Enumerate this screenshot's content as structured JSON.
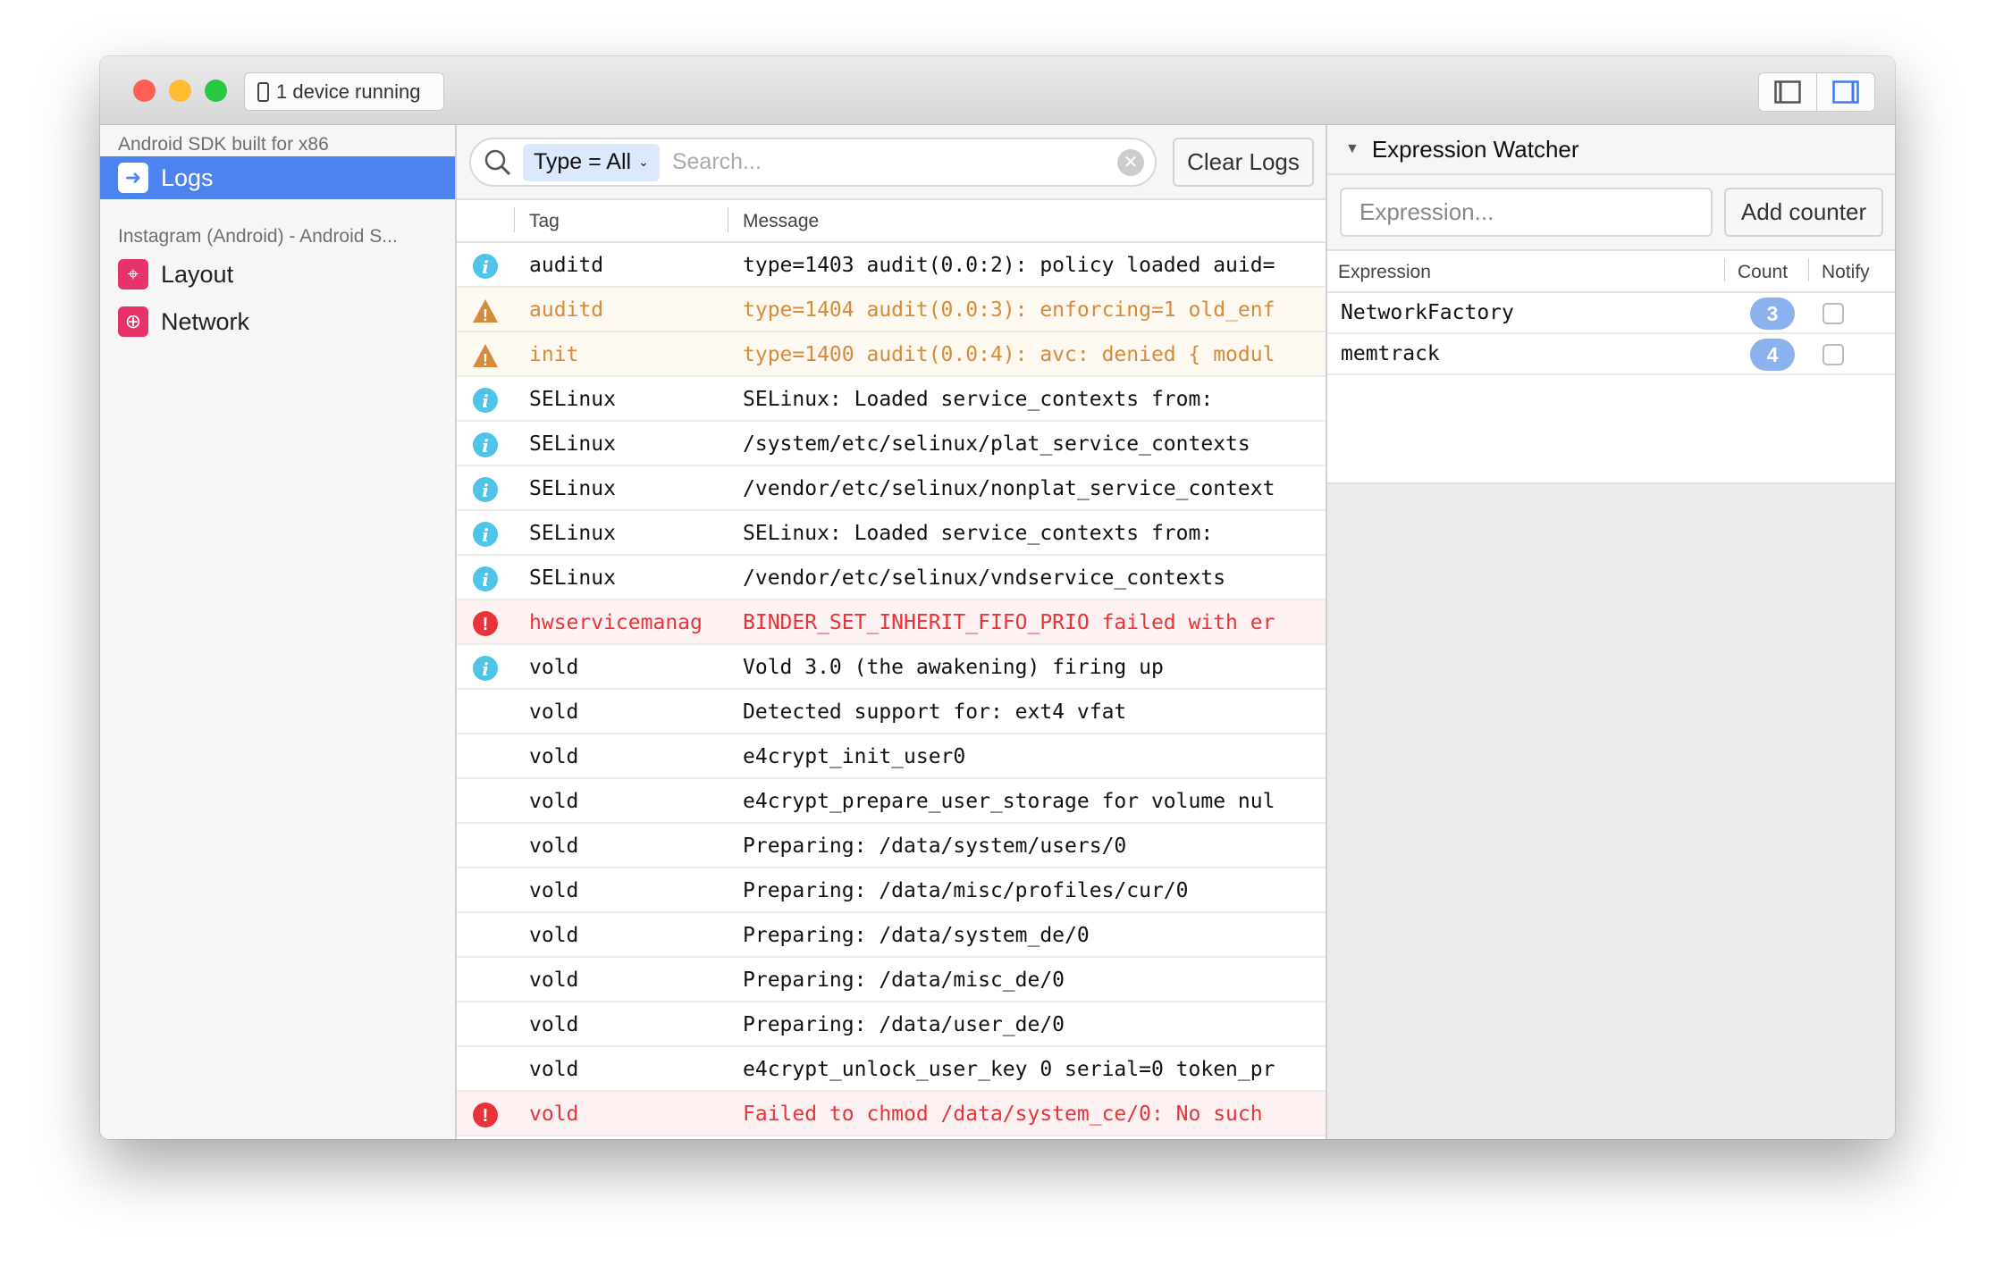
{
  "titlebar": {
    "device_button": "1 device running",
    "colors": {
      "close": "#fd5f57",
      "minimize": "#febc2e",
      "zoom": "#28c840"
    }
  },
  "sidebar": {
    "sections": [
      {
        "title": "Android SDK built for x86",
        "items": [
          {
            "label": "Logs",
            "icon": "arrow-right-icon",
            "active": true
          }
        ]
      },
      {
        "title": "Instagram (Android) - Android S...",
        "items": [
          {
            "label": "Layout",
            "icon": "target-icon"
          },
          {
            "label": "Network",
            "icon": "globe-icon"
          }
        ]
      }
    ],
    "accent": "#4d83ef",
    "plugin_icon_color": "#e8336a"
  },
  "logs": {
    "filter_pill": "Type = All",
    "search_placeholder": "Search...",
    "clear_button": "Clear Logs",
    "columns": {
      "tag": "Tag",
      "message": "Message"
    },
    "rows": [
      {
        "level": "info",
        "tag": "auditd",
        "message": "type=1403 audit(0.0:2): policy loaded auid="
      },
      {
        "level": "warn",
        "tag": "auditd",
        "message": "type=1404 audit(0.0:3): enforcing=1 old_enf"
      },
      {
        "level": "warn",
        "tag": "init",
        "message": "type=1400 audit(0.0:4): avc: denied { modul"
      },
      {
        "level": "info",
        "tag": "SELinux",
        "message": "SELinux: Loaded service_contexts from:"
      },
      {
        "level": "info",
        "tag": "SELinux",
        "message": "/system/etc/selinux/plat_service_contexts"
      },
      {
        "level": "info",
        "tag": "SELinux",
        "message": "/vendor/etc/selinux/nonplat_service_context"
      },
      {
        "level": "info",
        "tag": "SELinux",
        "message": "SELinux: Loaded service_contexts from:"
      },
      {
        "level": "info",
        "tag": "SELinux",
        "message": "/vendor/etc/selinux/vndservice_contexts"
      },
      {
        "level": "error",
        "tag": "hwservicemanag",
        "message": "BINDER_SET_INHERIT_FIFO_PRIO failed with er"
      },
      {
        "level": "info",
        "tag": "vold",
        "message": "Vold 3.0 (the awakening) firing up"
      },
      {
        "level": "none",
        "tag": "vold",
        "message": "Detected support for: ext4 vfat"
      },
      {
        "level": "none",
        "tag": "vold",
        "message": "e4crypt_init_user0"
      },
      {
        "level": "none",
        "tag": "vold",
        "message": "e4crypt_prepare_user_storage for volume nul"
      },
      {
        "level": "none",
        "tag": "vold",
        "message": "Preparing: /data/system/users/0"
      },
      {
        "level": "none",
        "tag": "vold",
        "message": "Preparing: /data/misc/profiles/cur/0"
      },
      {
        "level": "none",
        "tag": "vold",
        "message": "Preparing: /data/system_de/0"
      },
      {
        "level": "none",
        "tag": "vold",
        "message": "Preparing: /data/misc_de/0"
      },
      {
        "level": "none",
        "tag": "vold",
        "message": "Preparing: /data/user_de/0"
      },
      {
        "level": "none",
        "tag": "vold",
        "message": "e4crypt_unlock_user_key 0 serial=0 token_pr"
      },
      {
        "level": "error",
        "tag": "vold",
        "message": "Failed to chmod /data/system_ce/0: No such"
      }
    ],
    "level_colors": {
      "info": "#4fc3e8",
      "warn": "#d68b3a",
      "error": "#e8333a"
    }
  },
  "expression_watcher": {
    "title": "Expression Watcher",
    "input_placeholder": "Expression...",
    "add_button": "Add counter",
    "columns": {
      "expression": "Expression",
      "count": "Count",
      "notify": "Notify"
    },
    "rows": [
      {
        "expression": "NetworkFactory",
        "count": "3",
        "notify": false
      },
      {
        "expression": "memtrack",
        "count": "4",
        "notify": false
      }
    ]
  }
}
